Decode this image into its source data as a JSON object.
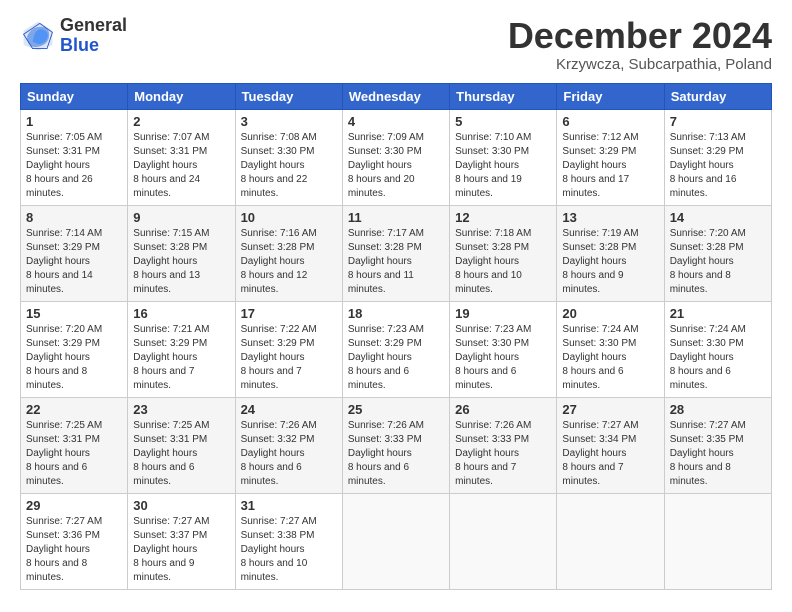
{
  "header": {
    "logo_general": "General",
    "logo_blue": "Blue",
    "month_title": "December 2024",
    "subtitle": "Krzywcza, Subcarpathia, Poland"
  },
  "days_of_week": [
    "Sunday",
    "Monday",
    "Tuesday",
    "Wednesday",
    "Thursday",
    "Friday",
    "Saturday"
  ],
  "weeks": [
    [
      {
        "num": "1",
        "sunrise": "7:05 AM",
        "sunset": "3:31 PM",
        "daylight": "8 hours and 26 minutes."
      },
      {
        "num": "2",
        "sunrise": "7:07 AM",
        "sunset": "3:31 PM",
        "daylight": "8 hours and 24 minutes."
      },
      {
        "num": "3",
        "sunrise": "7:08 AM",
        "sunset": "3:30 PM",
        "daylight": "8 hours and 22 minutes."
      },
      {
        "num": "4",
        "sunrise": "7:09 AM",
        "sunset": "3:30 PM",
        "daylight": "8 hours and 20 minutes."
      },
      {
        "num": "5",
        "sunrise": "7:10 AM",
        "sunset": "3:30 PM",
        "daylight": "8 hours and 19 minutes."
      },
      {
        "num": "6",
        "sunrise": "7:12 AM",
        "sunset": "3:29 PM",
        "daylight": "8 hours and 17 minutes."
      },
      {
        "num": "7",
        "sunrise": "7:13 AM",
        "sunset": "3:29 PM",
        "daylight": "8 hours and 16 minutes."
      }
    ],
    [
      {
        "num": "8",
        "sunrise": "7:14 AM",
        "sunset": "3:29 PM",
        "daylight": "8 hours and 14 minutes."
      },
      {
        "num": "9",
        "sunrise": "7:15 AM",
        "sunset": "3:28 PM",
        "daylight": "8 hours and 13 minutes."
      },
      {
        "num": "10",
        "sunrise": "7:16 AM",
        "sunset": "3:28 PM",
        "daylight": "8 hours and 12 minutes."
      },
      {
        "num": "11",
        "sunrise": "7:17 AM",
        "sunset": "3:28 PM",
        "daylight": "8 hours and 11 minutes."
      },
      {
        "num": "12",
        "sunrise": "7:18 AM",
        "sunset": "3:28 PM",
        "daylight": "8 hours and 10 minutes."
      },
      {
        "num": "13",
        "sunrise": "7:19 AM",
        "sunset": "3:28 PM",
        "daylight": "8 hours and 9 minutes."
      },
      {
        "num": "14",
        "sunrise": "7:20 AM",
        "sunset": "3:28 PM",
        "daylight": "8 hours and 8 minutes."
      }
    ],
    [
      {
        "num": "15",
        "sunrise": "7:20 AM",
        "sunset": "3:29 PM",
        "daylight": "8 hours and 8 minutes."
      },
      {
        "num": "16",
        "sunrise": "7:21 AM",
        "sunset": "3:29 PM",
        "daylight": "8 hours and 7 minutes."
      },
      {
        "num": "17",
        "sunrise": "7:22 AM",
        "sunset": "3:29 PM",
        "daylight": "8 hours and 7 minutes."
      },
      {
        "num": "18",
        "sunrise": "7:23 AM",
        "sunset": "3:29 PM",
        "daylight": "8 hours and 6 minutes."
      },
      {
        "num": "19",
        "sunrise": "7:23 AM",
        "sunset": "3:30 PM",
        "daylight": "8 hours and 6 minutes."
      },
      {
        "num": "20",
        "sunrise": "7:24 AM",
        "sunset": "3:30 PM",
        "daylight": "8 hours and 6 minutes."
      },
      {
        "num": "21",
        "sunrise": "7:24 AM",
        "sunset": "3:30 PM",
        "daylight": "8 hours and 6 minutes."
      }
    ],
    [
      {
        "num": "22",
        "sunrise": "7:25 AM",
        "sunset": "3:31 PM",
        "daylight": "8 hours and 6 minutes."
      },
      {
        "num": "23",
        "sunrise": "7:25 AM",
        "sunset": "3:31 PM",
        "daylight": "8 hours and 6 minutes."
      },
      {
        "num": "24",
        "sunrise": "7:26 AM",
        "sunset": "3:32 PM",
        "daylight": "8 hours and 6 minutes."
      },
      {
        "num": "25",
        "sunrise": "7:26 AM",
        "sunset": "3:33 PM",
        "daylight": "8 hours and 6 minutes."
      },
      {
        "num": "26",
        "sunrise": "7:26 AM",
        "sunset": "3:33 PM",
        "daylight": "8 hours and 7 minutes."
      },
      {
        "num": "27",
        "sunrise": "7:27 AM",
        "sunset": "3:34 PM",
        "daylight": "8 hours and 7 minutes."
      },
      {
        "num": "28",
        "sunrise": "7:27 AM",
        "sunset": "3:35 PM",
        "daylight": "8 hours and 8 minutes."
      }
    ],
    [
      {
        "num": "29",
        "sunrise": "7:27 AM",
        "sunset": "3:36 PM",
        "daylight": "8 hours and 8 minutes."
      },
      {
        "num": "30",
        "sunrise": "7:27 AM",
        "sunset": "3:37 PM",
        "daylight": "8 hours and 9 minutes."
      },
      {
        "num": "31",
        "sunrise": "7:27 AM",
        "sunset": "3:38 PM",
        "daylight": "8 hours and 10 minutes."
      },
      null,
      null,
      null,
      null
    ]
  ],
  "labels": {
    "sunrise": "Sunrise:",
    "sunset": "Sunset:",
    "daylight": "Daylight hours"
  }
}
